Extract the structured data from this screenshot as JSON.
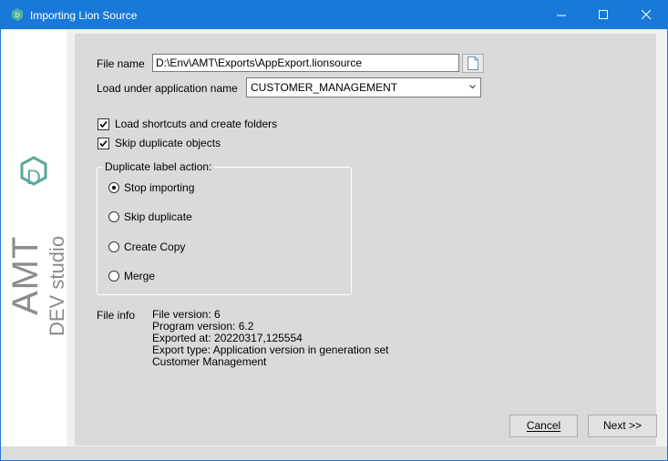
{
  "window": {
    "title": "Importing Lion Source",
    "title_bar_color": "#1879d9",
    "icon": "lion-app-icon"
  },
  "sidebar": {
    "logo_text": "AMT",
    "logo_subtext": "DEV studio",
    "logo_badge_letter": "D",
    "accent_color": "#5aa89a"
  },
  "form": {
    "file_name_label": "File name",
    "file_name_value": "D:\\Env\\AMT\\Exports\\AppExport.lionsource",
    "browse_icon": "document-icon",
    "app_name_label": "Load under application name",
    "app_name_value": "CUSTOMER_MANAGEMENT",
    "options": [
      {
        "label": "Load shortcuts and create folders",
        "checked": true
      },
      {
        "label": "Skip duplicate objects",
        "checked": true
      }
    ],
    "duplicate_group": {
      "title": "Duplicate label action:",
      "options": [
        {
          "label": "Stop importing",
          "selected": true
        },
        {
          "label": "Skip duplicate",
          "selected": false
        },
        {
          "label": "Create Copy",
          "selected": false
        },
        {
          "label": "Merge",
          "selected": false
        }
      ]
    },
    "file_info_label": "File info",
    "file_info_lines": [
      "File version: 6",
      "Program version: 6.2",
      "Exported at: 20220317,125554",
      "Export type: Application version in generation set",
      "Customer Management"
    ]
  },
  "buttons": {
    "cancel": "Cancel",
    "next": "Next >>"
  }
}
